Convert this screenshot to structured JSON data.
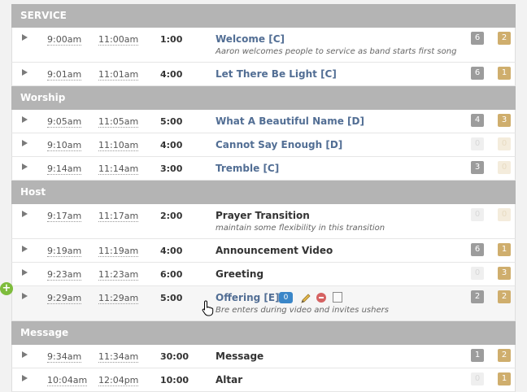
{
  "sections": [
    {
      "name": "SERVICE",
      "rows": [
        {
          "start": "9:00am",
          "end": "11:00am",
          "duration": "1:00",
          "title": "Welcome [C]",
          "note": "Aaron welcomes people to service as band starts first song",
          "link": true,
          "badge1": "6",
          "badge2": "2",
          "badge1_empty": false,
          "badge2_empty": false,
          "height": 43
        },
        {
          "start": "9:01am",
          "end": "11:01am",
          "duration": "4:00",
          "title": "Let There Be Light [C]",
          "note": "",
          "link": true,
          "badge1": "6",
          "badge2": "1",
          "badge1_empty": false,
          "badge2_empty": false,
          "height": 29
        }
      ]
    },
    {
      "name": "Worship",
      "rows": [
        {
          "start": "9:05am",
          "end": "11:05am",
          "duration": "5:00",
          "title": "What A Beautiful Name [D]",
          "note": "",
          "link": true,
          "badge1": "4",
          "badge2": "3",
          "badge1_empty": false,
          "badge2_empty": false,
          "height": 29
        },
        {
          "start": "9:10am",
          "end": "11:10am",
          "duration": "4:00",
          "title": "Cannot Say Enough [D]",
          "note": "",
          "link": true,
          "badge1": "0",
          "badge2": "0",
          "badge1_empty": true,
          "badge2_empty": true,
          "height": 29
        },
        {
          "start": "9:14am",
          "end": "11:14am",
          "duration": "3:00",
          "title": "Tremble [C]",
          "note": "",
          "link": true,
          "badge1": "3",
          "badge2": "0",
          "badge1_empty": false,
          "badge2_empty": true,
          "height": 29
        }
      ]
    },
    {
      "name": "Host",
      "rows": [
        {
          "start": "9:17am",
          "end": "11:17am",
          "duration": "2:00",
          "title": "Prayer Transition",
          "note": "maintain some flexibility in this transition",
          "link": false,
          "badge1": "0",
          "badge2": "0",
          "badge1_empty": true,
          "badge2_empty": true,
          "height": 43
        },
        {
          "start": "9:19am",
          "end": "11:19am",
          "duration": "4:00",
          "title": "Announcement Video",
          "note": "",
          "link": false,
          "badge1": "6",
          "badge2": "1",
          "badge1_empty": false,
          "badge2_empty": false,
          "height": 29
        },
        {
          "start": "9:23am",
          "end": "11:23am",
          "duration": "6:00",
          "title": "Greeting",
          "note": "",
          "link": false,
          "badge1": "0",
          "badge2": "3",
          "badge1_empty": true,
          "badge2_empty": false,
          "height": 29
        },
        {
          "start": "9:29am",
          "end": "11:29am",
          "duration": "5:00",
          "title": "Offering [E]",
          "note": "Bre enters during video and invites ushers",
          "link": true,
          "badge1": "2",
          "badge2": "2",
          "badge1_empty": false,
          "badge2_empty": false,
          "height": 43,
          "highlight": true,
          "count": "0"
        }
      ]
    },
    {
      "name": "Message",
      "rows": [
        {
          "start": "9:34am",
          "end": "11:34am",
          "duration": "30:00",
          "title": "Message",
          "note": "",
          "link": false,
          "badge1": "1",
          "badge2": "2",
          "badge1_empty": false,
          "badge2_empty": false,
          "height": 29
        },
        {
          "start": "10:04am",
          "end": "12:04pm",
          "duration": "10:00",
          "title": "Altar",
          "note": "",
          "link": false,
          "badge1": "0",
          "badge2": "1",
          "badge1_empty": true,
          "badge2_empty": false,
          "height": 29
        }
      ]
    }
  ],
  "add_button": "+"
}
